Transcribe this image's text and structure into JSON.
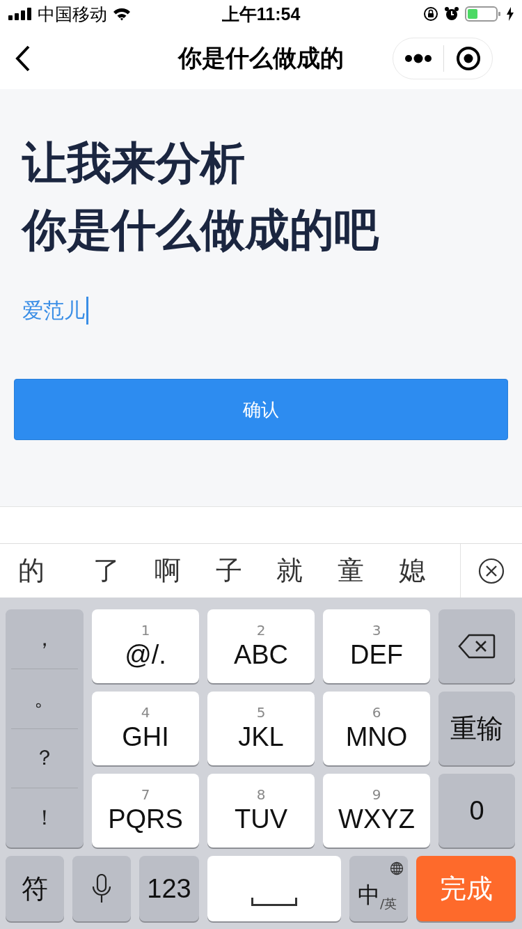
{
  "status_bar": {
    "carrier": "中国移动",
    "time": "上午11:54"
  },
  "nav": {
    "title": "你是什么做成的"
  },
  "headline": [
    "让我来分析",
    "你是什么做成的吧"
  ],
  "name_input": {
    "value": "爱范儿"
  },
  "confirm_button": "确认",
  "candidates": [
    "的",
    "了",
    "啊",
    "子",
    "就",
    "童",
    "媳"
  ],
  "keyboard": {
    "punctuation": [
      "，",
      "。",
      "？",
      "！"
    ],
    "t9_keys": [
      {
        "digit": "1",
        "letters": "@/."
      },
      {
        "digit": "2",
        "letters": "ABC"
      },
      {
        "digit": "3",
        "letters": "DEF"
      },
      {
        "digit": "4",
        "letters": "GHI"
      },
      {
        "digit": "5",
        "letters": "JKL"
      },
      {
        "digit": "6",
        "letters": "MNO"
      },
      {
        "digit": "7",
        "letters": "PQRS"
      },
      {
        "digit": "8",
        "letters": "TUV"
      },
      {
        "digit": "9",
        "letters": "WXYZ"
      }
    ],
    "side_keys": [
      {
        "kind": "delete"
      },
      {
        "kind": "text",
        "label": "重输"
      },
      {
        "kind": "text",
        "label": "0"
      }
    ],
    "bottom_keys": [
      {
        "kind": "text",
        "label": "符"
      },
      {
        "kind": "mic"
      },
      {
        "kind": "text",
        "label": "123"
      },
      {
        "kind": "space"
      },
      {
        "kind": "lang",
        "label": "中",
        "sub": "/英"
      },
      {
        "kind": "done",
        "label": "完成"
      }
    ]
  }
}
